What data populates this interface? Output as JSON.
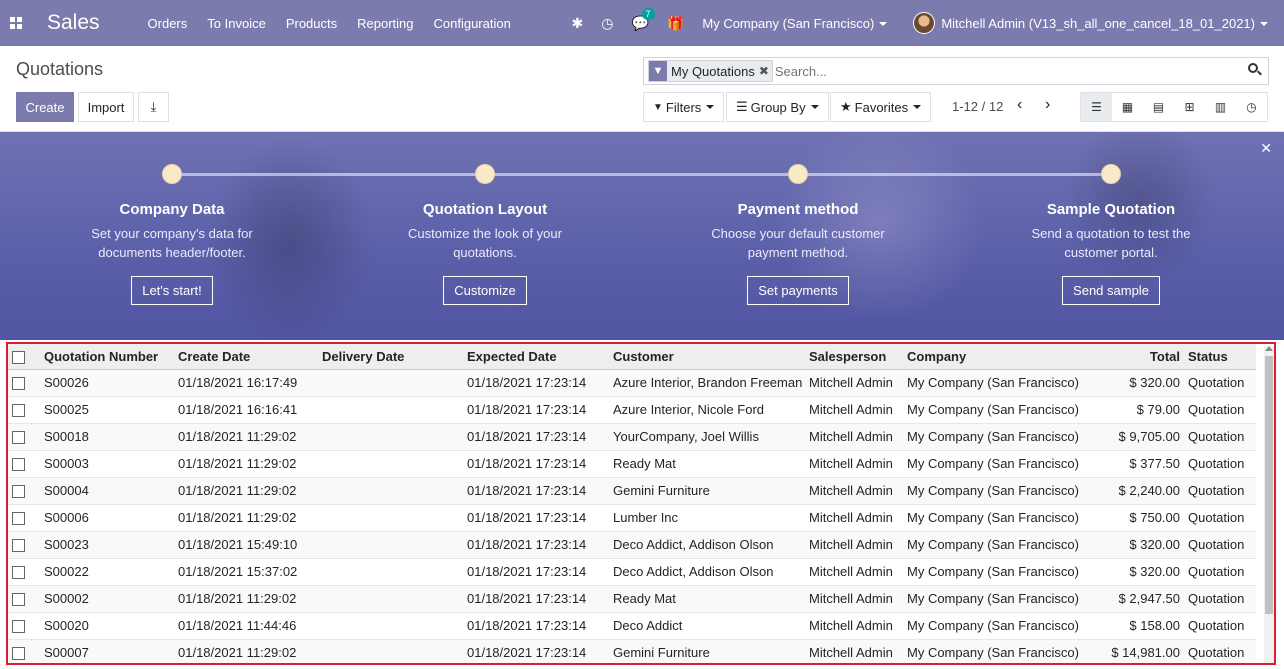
{
  "navbar": {
    "app_name": "Sales",
    "menu": [
      "Orders",
      "To Invoice",
      "Products",
      "Reporting",
      "Configuration"
    ],
    "messages_count": "7",
    "company": "My Company (San Francisco)",
    "user": "Mitchell Admin (V13_sh_all_one_cancel_18_01_2021)",
    "bg_color": "#7c7bad"
  },
  "control_panel": {
    "title": "Quotations",
    "create_label": "Create",
    "import_label": "Import",
    "facet_label": "My Quotations",
    "search_placeholder": "Search...",
    "filters_label": "Filters",
    "groupby_label": "Group By",
    "favorites_label": "Favorites",
    "pager_value": "1-12 / 12",
    "views": [
      "list",
      "kanban",
      "calendar",
      "pivot",
      "graph",
      "activity"
    ]
  },
  "onboarding": {
    "steps": [
      {
        "title": "Company Data",
        "desc": "Set your company's data for documents header/footer.",
        "button": "Let's start!"
      },
      {
        "title": "Quotation Layout",
        "desc": "Customize the look of your quotations.",
        "button": "Customize"
      },
      {
        "title": "Payment method",
        "desc": "Choose your default customer payment method.",
        "button": "Set payments"
      },
      {
        "title": "Sample Quotation",
        "desc": "Send a quotation to test the customer portal.",
        "button": "Send sample"
      }
    ]
  },
  "table": {
    "columns": [
      "Quotation Number",
      "Create Date",
      "Delivery Date",
      "Expected Date",
      "Customer",
      "Salesperson",
      "Company",
      "Total",
      "Status"
    ],
    "rows": [
      [
        "S00026",
        "01/18/2021 16:17:49",
        "",
        "01/18/2021 17:23:14",
        "Azure Interior, Brandon Freeman",
        "Mitchell Admin",
        "My Company (San Francisco)",
        "$ 320.00",
        "Quotation"
      ],
      [
        "S00025",
        "01/18/2021 16:16:41",
        "",
        "01/18/2021 17:23:14",
        "Azure Interior, Nicole Ford",
        "Mitchell Admin",
        "My Company (San Francisco)",
        "$ 79.00",
        "Quotation"
      ],
      [
        "S00018",
        "01/18/2021 11:29:02",
        "",
        "01/18/2021 17:23:14",
        "YourCompany, Joel Willis",
        "Mitchell Admin",
        "My Company (San Francisco)",
        "$ 9,705.00",
        "Quotation"
      ],
      [
        "S00003",
        "01/18/2021 11:29:02",
        "",
        "01/18/2021 17:23:14",
        "Ready Mat",
        "Mitchell Admin",
        "My Company (San Francisco)",
        "$ 377.50",
        "Quotation"
      ],
      [
        "S00004",
        "01/18/2021 11:29:02",
        "",
        "01/18/2021 17:23:14",
        "Gemini Furniture",
        "Mitchell Admin",
        "My Company (San Francisco)",
        "$ 2,240.00",
        "Quotation"
      ],
      [
        "S00006",
        "01/18/2021 11:29:02",
        "",
        "01/18/2021 17:23:14",
        "Lumber Inc",
        "Mitchell Admin",
        "My Company (San Francisco)",
        "$ 750.00",
        "Quotation"
      ],
      [
        "S00023",
        "01/18/2021 15:49:10",
        "",
        "01/18/2021 17:23:14",
        "Deco Addict, Addison Olson",
        "Mitchell Admin",
        "My Company (San Francisco)",
        "$ 320.00",
        "Quotation"
      ],
      [
        "S00022",
        "01/18/2021 15:37:02",
        "",
        "01/18/2021 17:23:14",
        "Deco Addict, Addison Olson",
        "Mitchell Admin",
        "My Company (San Francisco)",
        "$ 320.00",
        "Quotation"
      ],
      [
        "S00002",
        "01/18/2021 11:29:02",
        "",
        "01/18/2021 17:23:14",
        "Ready Mat",
        "Mitchell Admin",
        "My Company (San Francisco)",
        "$ 2,947.50",
        "Quotation"
      ],
      [
        "S00020",
        "01/18/2021 11:44:46",
        "",
        "01/18/2021 17:23:14",
        "Deco Addict",
        "Mitchell Admin",
        "My Company (San Francisco)",
        "$ 158.00",
        "Quotation"
      ],
      [
        "S00007",
        "01/18/2021 11:29:02",
        "",
        "01/18/2021 17:23:14",
        "Gemini Furniture",
        "Mitchell Admin",
        "My Company (San Francisco)",
        "$ 14,981.00",
        "Quotation"
      ]
    ]
  }
}
